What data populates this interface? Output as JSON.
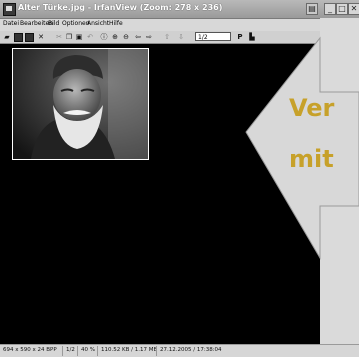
{
  "window": {
    "title": "Alter Türke.jpg - IrfanView (Zoom: 278 x 236)",
    "controls": {
      "minimize": "_",
      "maximize": "□",
      "close": "✕"
    }
  },
  "menu": [
    "Datei",
    "Bearbeiten",
    "Bild",
    "Optionen",
    "Ansicht",
    "Hilfe"
  ],
  "toolbar": {
    "icons": [
      "open-icon",
      "save-icon",
      "save-as-icon",
      "delete-icon",
      "cut-icon",
      "copy-icon",
      "paste-icon",
      "undo-icon",
      "info-icon",
      "zoom-in-icon",
      "zoom-out-icon",
      "prev-icon",
      "next-icon",
      "prev-page-icon",
      "next-page-icon",
      "print-icon",
      "scan-icon"
    ],
    "page_field": "1/2"
  },
  "overlay": {
    "line1": "Ver",
    "line2": "mit",
    "arrow_fill": "#d8d8d8",
    "text_color": "#c7a12a"
  },
  "status": {
    "dimensions": "694 x 590 x 24 BPP",
    "page": "1/2",
    "zoom": "40 %",
    "size": "110.52 KB / 1.17 MB",
    "date": "27.12.2005 / 17:38:04"
  }
}
